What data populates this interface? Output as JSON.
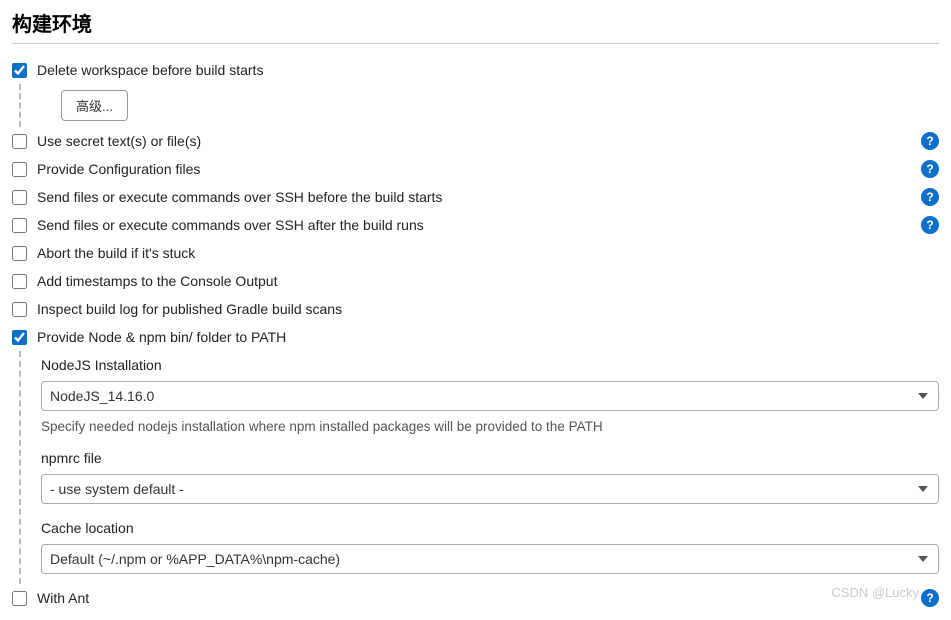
{
  "section_title": "构建环境",
  "advanced_button": "高级...",
  "options": {
    "delete_workspace": {
      "label": "Delete workspace before build starts",
      "checked": true,
      "help": false
    },
    "use_secret": {
      "label": "Use secret text(s) or file(s)",
      "checked": false,
      "help": true
    },
    "provide_config": {
      "label": "Provide Configuration files",
      "checked": false,
      "help": true
    },
    "ssh_before": {
      "label": "Send files or execute commands over SSH before the build starts",
      "checked": false,
      "help": true
    },
    "ssh_after": {
      "label": "Send files or execute commands over SSH after the build runs",
      "checked": false,
      "help": true
    },
    "abort_stuck": {
      "label": "Abort the build if it's stuck",
      "checked": false,
      "help": false
    },
    "add_timestamps": {
      "label": "Add timestamps to the Console Output",
      "checked": false,
      "help": false
    },
    "inspect_gradle": {
      "label": "Inspect build log for published Gradle build scans",
      "checked": false,
      "help": false
    },
    "provide_node": {
      "label": "Provide Node & npm bin/ folder to PATH",
      "checked": true,
      "help": false
    },
    "with_ant": {
      "label": "With Ant",
      "checked": false,
      "help": true
    }
  },
  "node_section": {
    "install_label": "NodeJS Installation",
    "install_value": "NodeJS_14.16.0",
    "install_help": "Specify needed nodejs installation where npm installed packages will be provided to the PATH",
    "npmrc_label": "npmrc file",
    "npmrc_value": "- use system default -",
    "cache_label": "Cache location",
    "cache_value": "Default (~/.npm or %APP_DATA%\\npm-cache)"
  },
  "help_glyph": "?",
  "watermark": "CSDN @Lucky",
  "colors": {
    "accent": "#0b6fcb"
  }
}
